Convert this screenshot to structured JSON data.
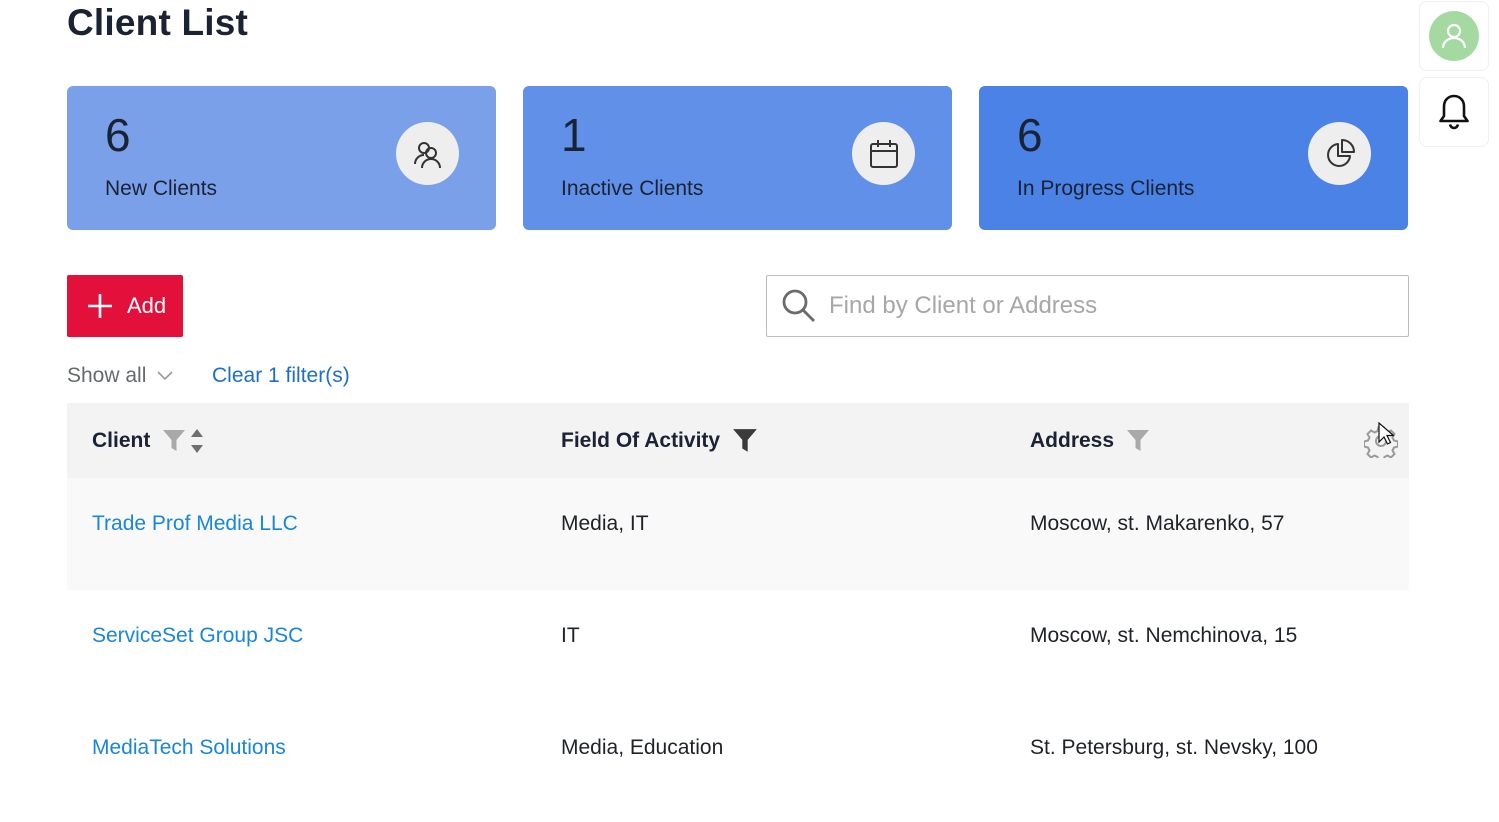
{
  "page": {
    "title": "Client List"
  },
  "stats": [
    {
      "value": "6",
      "label": "New Clients",
      "icon": "users-icon"
    },
    {
      "value": "1",
      "label": "Inactive Clients",
      "icon": "calendar-icon"
    },
    {
      "value": "6",
      "label": "In Progress Clients",
      "icon": "pie-chart-icon"
    }
  ],
  "toolbar": {
    "add_label": "Add",
    "search_placeholder": "Find by Client or Address",
    "search_value": ""
  },
  "filters": {
    "show_label": "Show all",
    "clear_label": "Clear 1 filter(s)"
  },
  "table": {
    "columns": [
      "Client",
      "Field Of Activity",
      "Address"
    ],
    "rows": [
      {
        "client": "Trade Prof Media LLC",
        "activity": "Media, IT",
        "address": "Moscow, st. Makarenko, 57"
      },
      {
        "client": "ServiceSet Group JSC",
        "activity": "IT",
        "address": "Moscow, st. Nemchinova, 15"
      },
      {
        "client": "MediaTech Solutions",
        "activity": "Media, Education",
        "address": "St. Petersburg, st. Nevsky, 100"
      }
    ]
  },
  "colors": {
    "card_1": "#7aa0ea",
    "card_2": "#6190e8",
    "card_3": "#4b82e6",
    "add_button": "#e3103b",
    "link": "#1a86d8",
    "avatar": "#a4d9a2"
  }
}
